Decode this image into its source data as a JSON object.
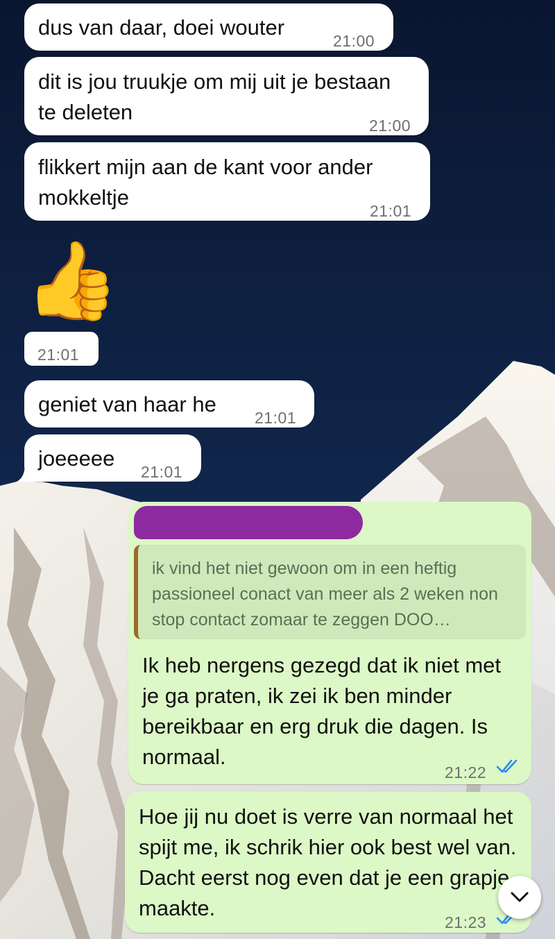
{
  "messages": [
    {
      "text": "dus van daar, doei wouter",
      "time": "21:00"
    },
    {
      "text": "dit is jou truukje om mij uit je bestaan te deleten",
      "time": "21:00"
    },
    {
      "text": "flikkert mijn aan de kant voor ander mokkeltje",
      "time": "21:01"
    },
    {
      "emoji": "👍",
      "time": "21:01"
    },
    {
      "text": "geniet van haar he",
      "time": "21:01"
    },
    {
      "text": "joeeeee",
      "time": "21:01"
    }
  ],
  "sent": [
    {
      "quote": "ik vind het niet gewoon om in een heftig passioneel conact van meer als 2 weken non stop contact zomaar te zeggen DOO…",
      "text": "Ik heb nergens gezegd dat ik niet met je ga praten, ik zei ik ben minder bereikbaar en erg druk die dagen. Is normaal.",
      "time": "21:22",
      "status": "read"
    },
    {
      "text": "Hoe jij nu doet is verre van normaal het spijt me, ik schrik hier ook best wel van. Dacht eerst nog even dat je een grapje maakte.",
      "time": "21:23",
      "status": "read"
    }
  ],
  "icons": {
    "read_ticks": "double-check-icon",
    "scroll_down": "chevron-down-icon"
  },
  "colors": {
    "incoming": "#ffffff",
    "outgoing": "#dcf8c6",
    "read_tick": "#2a8cf0",
    "redaction": "#8e2aa0"
  }
}
